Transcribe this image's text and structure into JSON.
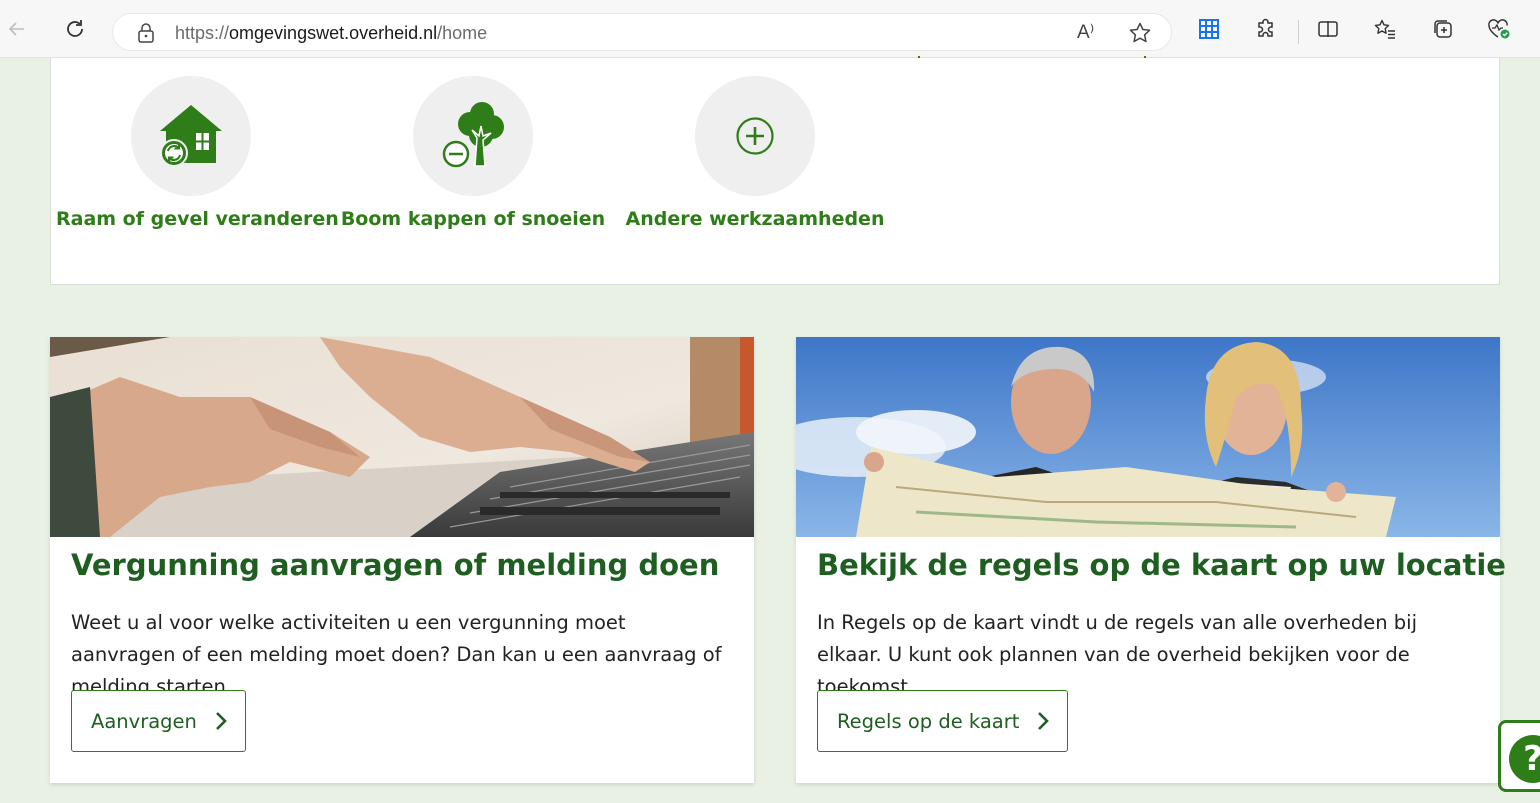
{
  "browser": {
    "url_scheme": "https://",
    "url_host": "omgevingswet.overheid.nl",
    "url_path": "/home",
    "read_aloud": "A⁾"
  },
  "categories": [
    {
      "label": "Raam of gevel veranderen",
      "icon": "house-window-icon"
    },
    {
      "label": "Boom kappen of snoeien",
      "icon": "tree-minus-icon"
    },
    {
      "label": "Andere werkzaamheden",
      "icon": "plus-circle-icon"
    }
  ],
  "cards": [
    {
      "title": "Vergunning aanvragen of melding doen",
      "text": "Weet u al voor welke activiteiten u een vergunning moet aanvragen of een melding moet doen? Dan kan u een aanvraag of melding starten.",
      "button": "Aanvragen",
      "image": "laptop-typing-photo"
    },
    {
      "title": "Bekijk de regels op de kaart op uw locatie",
      "text": "In Regels op de kaart vindt u de regels van alle overheden bij elkaar. U kunt ook plannen van de overheid bekijken voor de toekomst",
      "button": "Regels op de kaart",
      "image": "people-with-map-photo"
    }
  ],
  "help": {
    "glyph": "?"
  },
  "colors": {
    "brand_green": "#2e7d18",
    "title_green": "#1e5e21",
    "page_bg": "#e9f1e4"
  }
}
